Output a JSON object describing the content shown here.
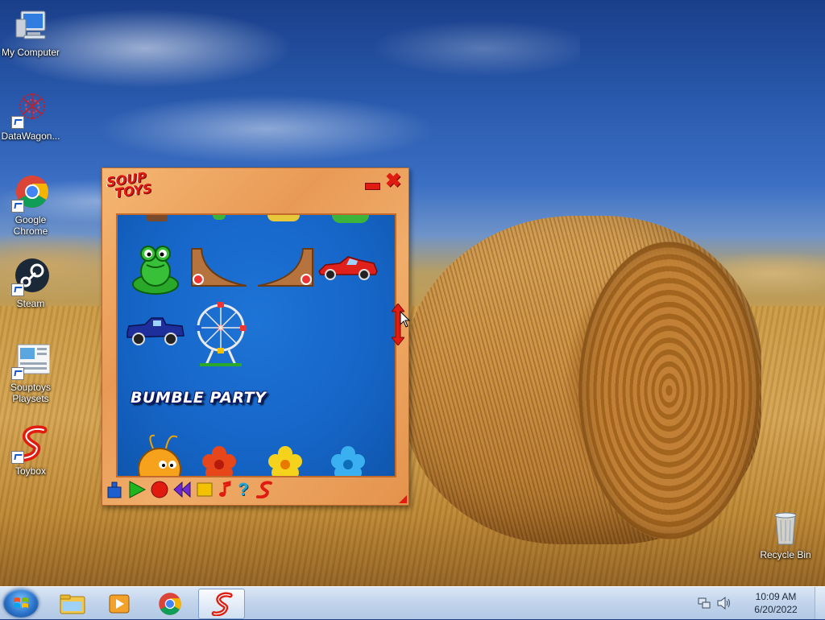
{
  "desktop": {
    "icons": [
      {
        "label": "My Computer",
        "icon": "computer-icon"
      },
      {
        "label": "DataWagon...",
        "icon": "datawagon-icon"
      },
      {
        "label": "Google Chrome",
        "icon": "chrome-icon"
      },
      {
        "label": "Steam",
        "icon": "steam-icon"
      },
      {
        "label": "Souptoys Playsets",
        "icon": "playsets-icon"
      },
      {
        "label": "Toybox",
        "icon": "toybox-icon"
      },
      {
        "label": "Recycle Bin",
        "icon": "recycle-bin-icon"
      }
    ]
  },
  "souptoys": {
    "logo_line1": "SOUP",
    "logo_line2": "TOYS",
    "toys": {
      "banner": "BUMBLE PARTY"
    },
    "colors": {
      "accent": "#e01b10",
      "panel": "#1565c7",
      "frame": "#f0ad6a"
    },
    "toolbar": [
      {
        "name": "robot-tool-icon",
        "color": "#1e5fd0"
      },
      {
        "name": "play-icon",
        "color": "#1fb51f"
      },
      {
        "name": "record-icon",
        "color": "#e01b10"
      },
      {
        "name": "rewind-icon",
        "color": "#6b2bd0"
      },
      {
        "name": "stop-icon",
        "color": "#f2c200"
      },
      {
        "name": "music-icon",
        "color": "#e01b10"
      },
      {
        "name": "help-icon",
        "color": "#1ea7d8"
      },
      {
        "name": "souptoys-logo-icon",
        "color": "#e01b10"
      }
    ]
  },
  "taskbar": {
    "apps": [
      {
        "name": "explorer-icon"
      },
      {
        "name": "media-player-icon"
      },
      {
        "name": "chrome-icon"
      },
      {
        "name": "souptoys-icon",
        "active": true
      }
    ],
    "clock": {
      "time": "10:09 AM",
      "date": "6/20/2022"
    }
  }
}
